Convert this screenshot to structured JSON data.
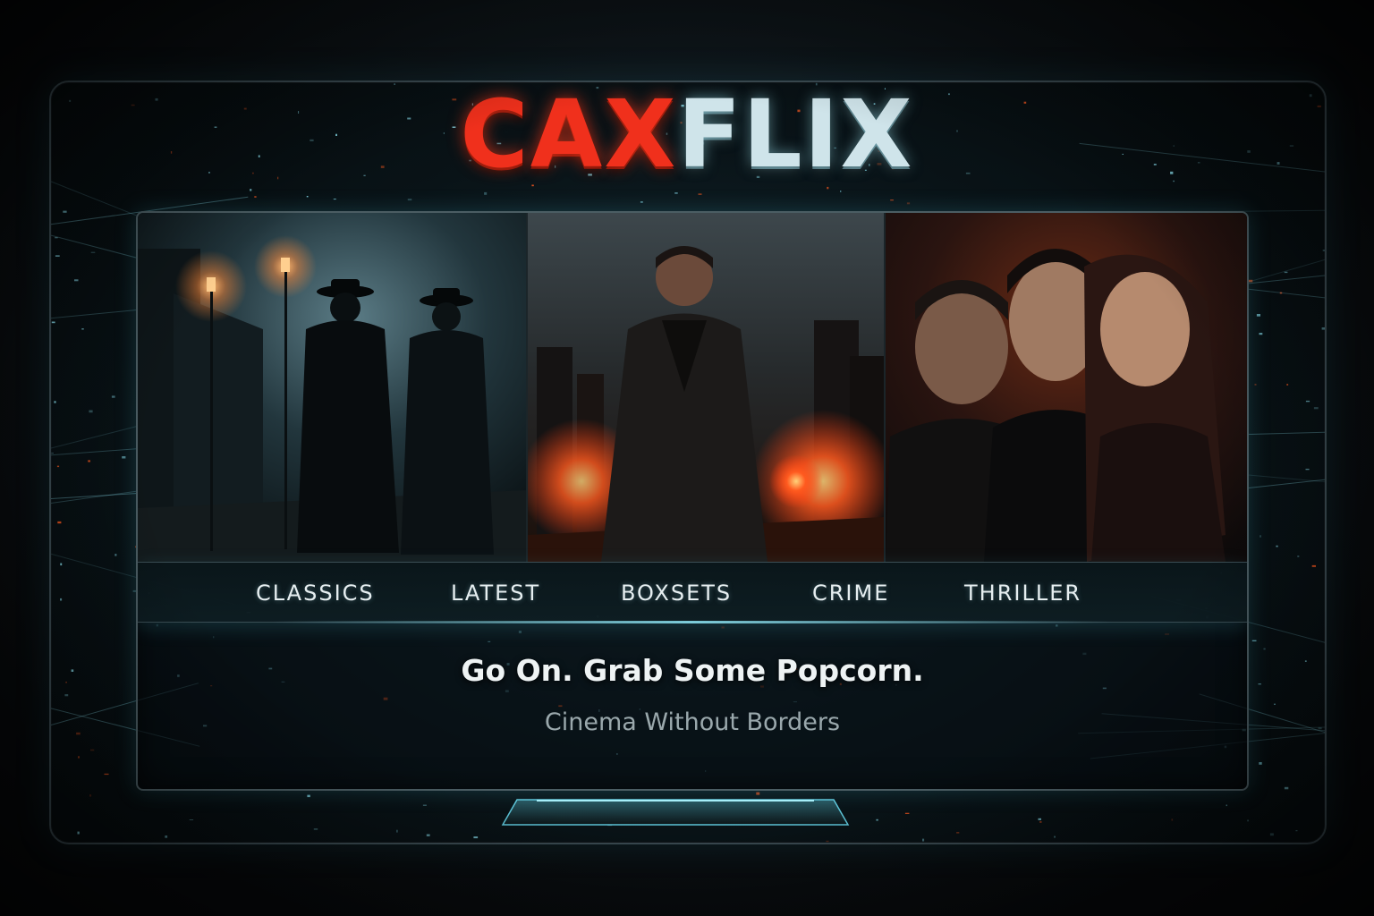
{
  "app": {
    "logo_part1": "CAX",
    "logo_part2": "FLIX",
    "logo_color_primary": "#f0301c",
    "logo_color_secondary": "#cfe4ea"
  },
  "posters": [
    {
      "name": "classic-noir-poster",
      "icon": "noir-detectives-image"
    },
    {
      "name": "action-hero-poster",
      "icon": "action-hero-image"
    },
    {
      "name": "thriller-cast-poster",
      "icon": "thriller-cast-image"
    }
  ],
  "nav": {
    "items": [
      {
        "label": "CLASSICS"
      },
      {
        "label": "LATEST"
      },
      {
        "label": "BOXSETS"
      },
      {
        "label": "CRIME"
      },
      {
        "label": "THRILLER"
      }
    ]
  },
  "main": {
    "tagline": "Go On. Grab Some Popcorn.",
    "subtagline": "Cinema Without Borders"
  },
  "colors": {
    "accent_cyan": "#8ee6f5",
    "accent_orange": "#ff5a1f",
    "background": "#07090b"
  }
}
